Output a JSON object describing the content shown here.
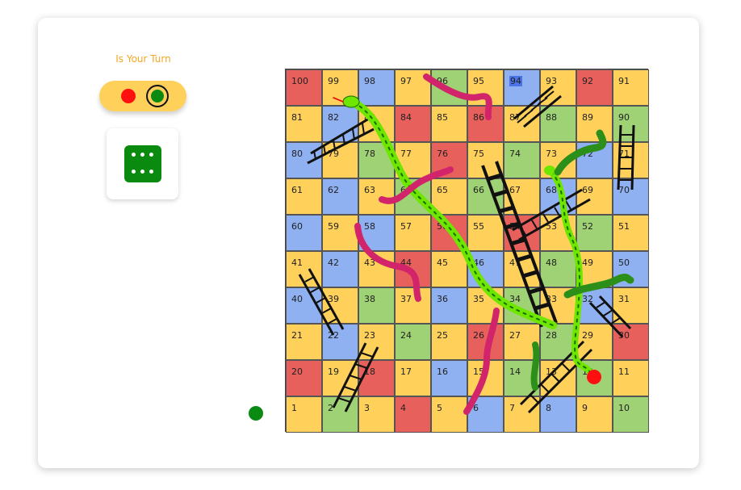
{
  "status": {
    "turn_text": "Is Your Turn"
  },
  "players": [
    {
      "name": "red",
      "color": "#ff1010",
      "active": false
    },
    {
      "name": "green",
      "color": "#0a8a12",
      "active": true
    }
  ],
  "dice": {
    "value": 6,
    "color": "#0b8a10"
  },
  "board": {
    "colors": {
      "red": "#e8605c",
      "yellow": "#ffd15a",
      "blue": "#8fb1f2",
      "green": "#9fd275",
      "highlight": "#4a73e8"
    },
    "rows": [
      {
        "numbers": [
          "100",
          "99",
          "98",
          "97",
          "96",
          "95",
          "94",
          "93",
          "92",
          "91"
        ],
        "colors": [
          "red",
          "yellow",
          "blue",
          "yellow",
          "green",
          "yellow",
          "blue",
          "yellow",
          "red",
          "yellow"
        ]
      },
      {
        "numbers": [
          "81",
          "82",
          "83",
          "84",
          "85",
          "86",
          "87",
          "88",
          "89",
          "90"
        ],
        "colors": [
          "yellow",
          "blue",
          "yellow",
          "red",
          "yellow",
          "red",
          "yellow",
          "green",
          "yellow",
          "green"
        ]
      },
      {
        "numbers": [
          "80",
          "79",
          "78",
          "77",
          "76",
          "75",
          "74",
          "73",
          "72",
          "71"
        ],
        "colors": [
          "blue",
          "yellow",
          "green",
          "yellow",
          "red",
          "yellow",
          "green",
          "yellow",
          "blue",
          "yellow"
        ]
      },
      {
        "numbers": [
          "61",
          "62",
          "63",
          "64",
          "65",
          "66",
          "67",
          "68",
          "69",
          "70"
        ],
        "colors": [
          "yellow",
          "blue",
          "yellow",
          "green",
          "yellow",
          "green",
          "yellow",
          "blue",
          "yellow",
          "blue"
        ]
      },
      {
        "numbers": [
          "60",
          "59",
          "58",
          "57",
          "56",
          "55",
          "54",
          "53",
          "52",
          "51"
        ],
        "colors": [
          "blue",
          "yellow",
          "blue",
          "yellow",
          "red",
          "yellow",
          "red",
          "yellow",
          "green",
          "yellow"
        ]
      },
      {
        "numbers": [
          "41",
          "42",
          "43",
          "44",
          "45",
          "46",
          "47",
          "48",
          "49",
          "50"
        ],
        "colors": [
          "yellow",
          "blue",
          "yellow",
          "red",
          "yellow",
          "blue",
          "yellow",
          "green",
          "yellow",
          "blue"
        ]
      },
      {
        "numbers": [
          "40",
          "39",
          "38",
          "37",
          "36",
          "35",
          "34",
          "33",
          "32",
          "31"
        ],
        "colors": [
          "blue",
          "yellow",
          "green",
          "yellow",
          "blue",
          "yellow",
          "green",
          "yellow",
          "blue",
          "yellow"
        ]
      },
      {
        "numbers": [
          "21",
          "22",
          "23",
          "24",
          "25",
          "26",
          "27",
          "28",
          "29",
          "30"
        ],
        "colors": [
          "yellow",
          "blue",
          "yellow",
          "green",
          "yellow",
          "red",
          "yellow",
          "green",
          "yellow",
          "red"
        ]
      },
      {
        "numbers": [
          "20",
          "19",
          "18",
          "17",
          "16",
          "15",
          "14",
          "13",
          "12",
          "11"
        ],
        "colors": [
          "red",
          "yellow",
          "red",
          "yellow",
          "blue",
          "yellow",
          "green",
          "yellow",
          "green",
          "yellow"
        ]
      },
      {
        "numbers": [
          "1",
          "2",
          "3",
          "4",
          "5",
          "6",
          "7",
          "8",
          "9",
          "10"
        ],
        "colors": [
          "yellow",
          "green",
          "yellow",
          "red",
          "yellow",
          "blue",
          "yellow",
          "blue",
          "yellow",
          "green"
        ]
      }
    ],
    "highlighted_square": "94"
  },
  "tokens": {
    "red_square": "12",
    "green_square": "0"
  }
}
